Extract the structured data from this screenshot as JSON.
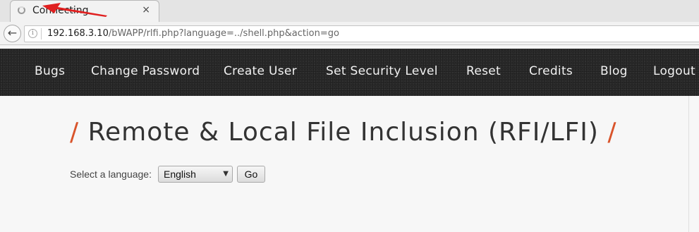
{
  "browser": {
    "tab": {
      "title": "Connecting",
      "close_glyph": "×",
      "loading_icon": "spinner-icon"
    },
    "address_bar": {
      "back_glyph": "←",
      "info_glyph": "i",
      "url_host": "192.168.3.10",
      "url_path": "/bWAPP/rlfi.php?language=../shell.php&action=go"
    },
    "annotation": {
      "icon": "red-arrow-icon",
      "color": "#e02020"
    }
  },
  "navbar": {
    "items": [
      {
        "label": "Bugs"
      },
      {
        "label": "Change Password"
      },
      {
        "label": "Create User"
      },
      {
        "label": "Set Security Level"
      },
      {
        "label": "Reset"
      },
      {
        "label": "Credits"
      },
      {
        "label": "Blog"
      },
      {
        "label": "Logout"
      }
    ]
  },
  "main": {
    "heading_prefix": "/",
    "heading": "Remote & Local File Inclusion (RFI/LFI)",
    "heading_suffix": "/",
    "accent_color": "#d9542b",
    "form": {
      "label": "Select a language:",
      "selected_language": "English",
      "caret_glyph": "▼",
      "submit_label": "Go"
    }
  }
}
